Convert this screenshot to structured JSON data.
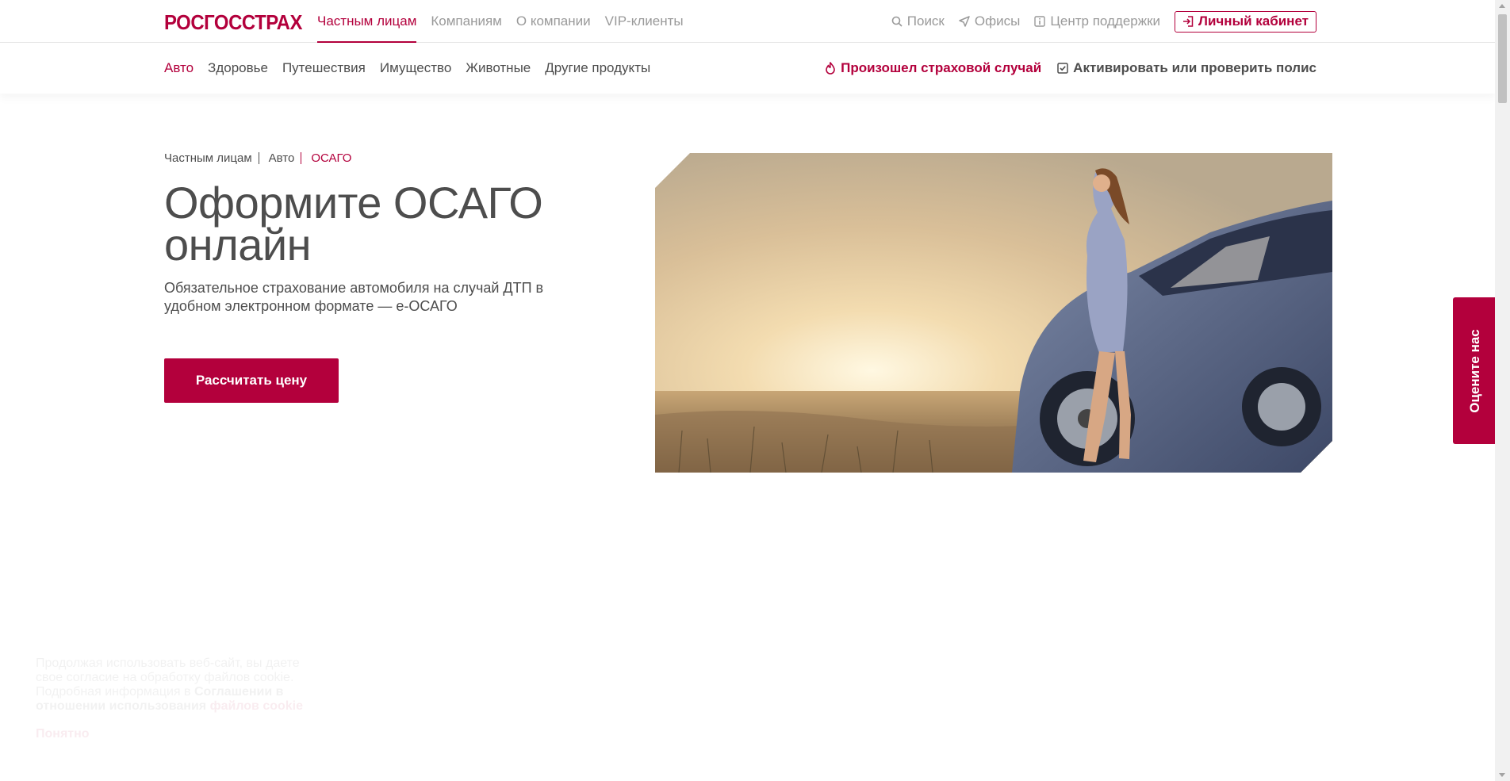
{
  "header": {
    "logo": "РОСГОССТРАХ",
    "nav": [
      "Частным лицам",
      "Компаниям",
      "О компании",
      "VIP-клиенты"
    ],
    "active_nav": "Частным лицам",
    "search": "Поиск",
    "offices": "Офисы",
    "support": "Центр поддержки",
    "cabinet": "Личный кабинет"
  },
  "subnav": {
    "items": [
      "Авто",
      "Здоровье",
      "Путешествия",
      "Имущество",
      "Животные",
      "Другие продукты"
    ],
    "active": "Авто",
    "accident": "Произошел страховой случай",
    "activate": "Активировать или проверить полис"
  },
  "breadcrumb": [
    "Частным лицам",
    "Авто",
    "ОСАГО"
  ],
  "hero": {
    "title": "Оформите ОСАГО онлайн",
    "subtitle": "Обязательное страхование автомобиля на случай ДТП в удобном электронном формате — е-ОСАГО",
    "cta": "Рассчитать цену"
  },
  "rate_tab": "Оцените нас",
  "cookie": {
    "text": "Продолжая использовать веб-сайт, вы даете свое согласие на обработку файлов cookie. Подробная информация в",
    "bold": "Соглашении в отношении использования",
    "link": "файлов cookie",
    "ok": "Понятно"
  },
  "colors": {
    "brand": "#b3003c",
    "text": "#4d4d4d",
    "muted": "#999999"
  }
}
